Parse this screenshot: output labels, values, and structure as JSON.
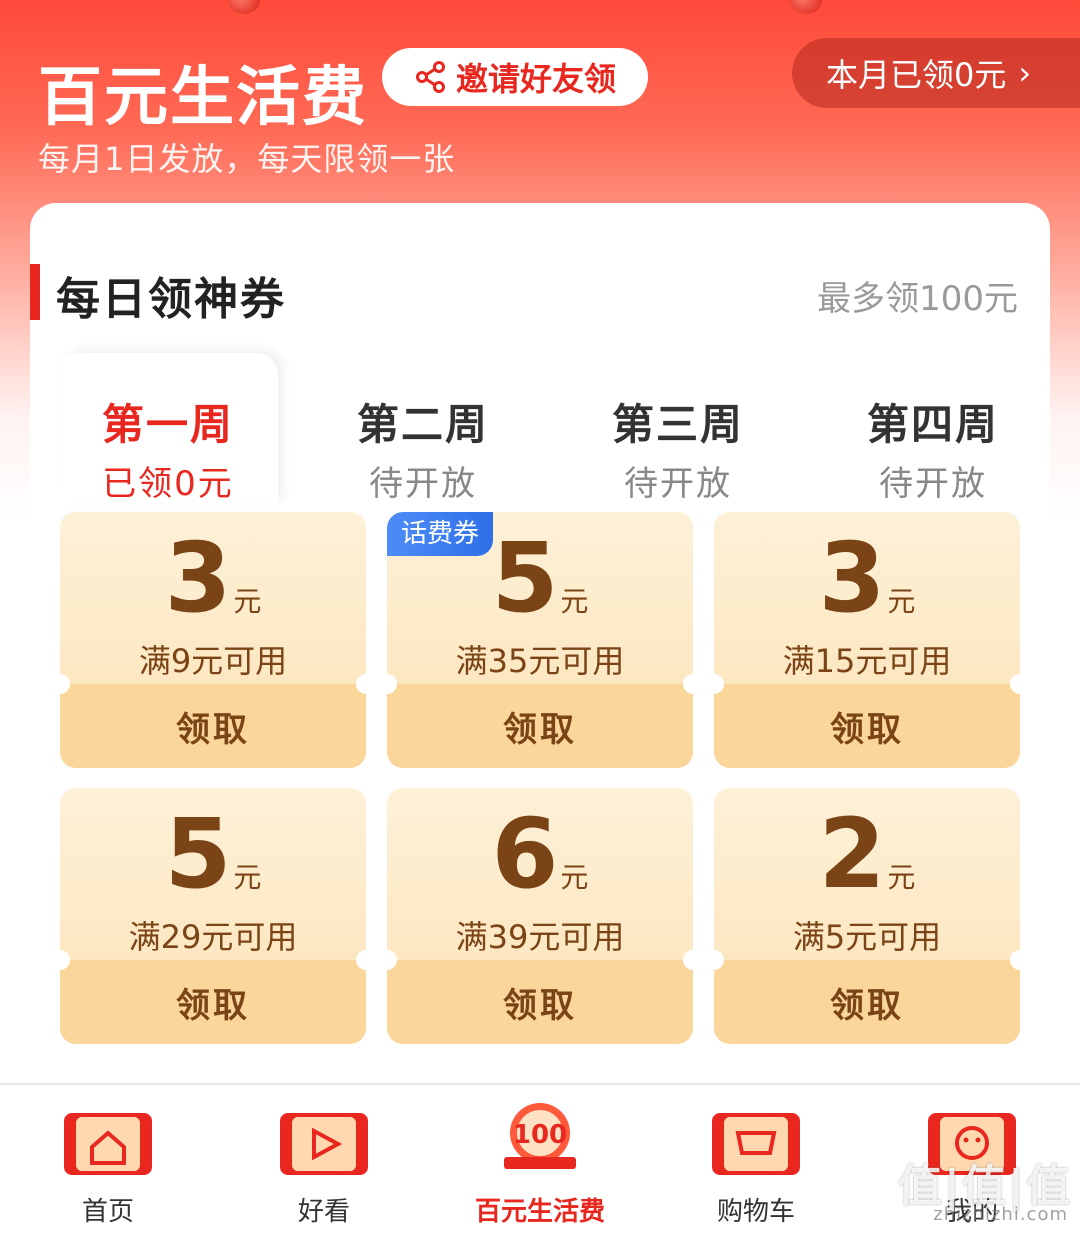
{
  "header": {
    "title": "百元生活费",
    "invite_label": "邀请好友领",
    "subtitle": "每月1日发放，每天限领一张",
    "claimed_label": "本月已领0元"
  },
  "section": {
    "title": "每日领神券",
    "max_label": "最多领100元"
  },
  "weeks": [
    {
      "name": "第一周",
      "status": "已领0元",
      "active": true
    },
    {
      "name": "第二周",
      "status": "待开放",
      "active": false
    },
    {
      "name": "第三周",
      "status": "待开放",
      "active": false
    },
    {
      "name": "第四周",
      "status": "待开放",
      "active": false
    }
  ],
  "coupons": [
    {
      "amount": "3",
      "unit": "元",
      "condition": "满9元可用",
      "claim": "领取",
      "tag": ""
    },
    {
      "amount": "5",
      "unit": "元",
      "condition": "满35元可用",
      "claim": "领取",
      "tag": "话费券"
    },
    {
      "amount": "3",
      "unit": "元",
      "condition": "满15元可用",
      "claim": "领取",
      "tag": ""
    },
    {
      "amount": "5",
      "unit": "元",
      "condition": "满29元可用",
      "claim": "领取",
      "tag": ""
    },
    {
      "amount": "6",
      "unit": "元",
      "condition": "满39元可用",
      "claim": "领取",
      "tag": ""
    },
    {
      "amount": "2",
      "unit": "元",
      "condition": "满5元可用",
      "claim": "领取",
      "tag": ""
    }
  ],
  "nav": [
    {
      "label": "首页",
      "icon": "home-icon"
    },
    {
      "label": "好看",
      "icon": "play-icon"
    },
    {
      "label": "百元生活费",
      "icon": "badge-100-icon",
      "badge_text": "100"
    },
    {
      "label": "购物车",
      "icon": "cart-icon"
    },
    {
      "label": "我的",
      "icon": "profile-icon"
    }
  ],
  "watermark": {
    "text": "值|值|值",
    "site": "zhizhizhi.com"
  },
  "colors": {
    "accent": "#e8271f",
    "coupon_text": "#7a4416",
    "coupon_bg": "#fdeccc",
    "claim_bg": "#fbd69b",
    "tag_blue": "#2d6fe8"
  }
}
